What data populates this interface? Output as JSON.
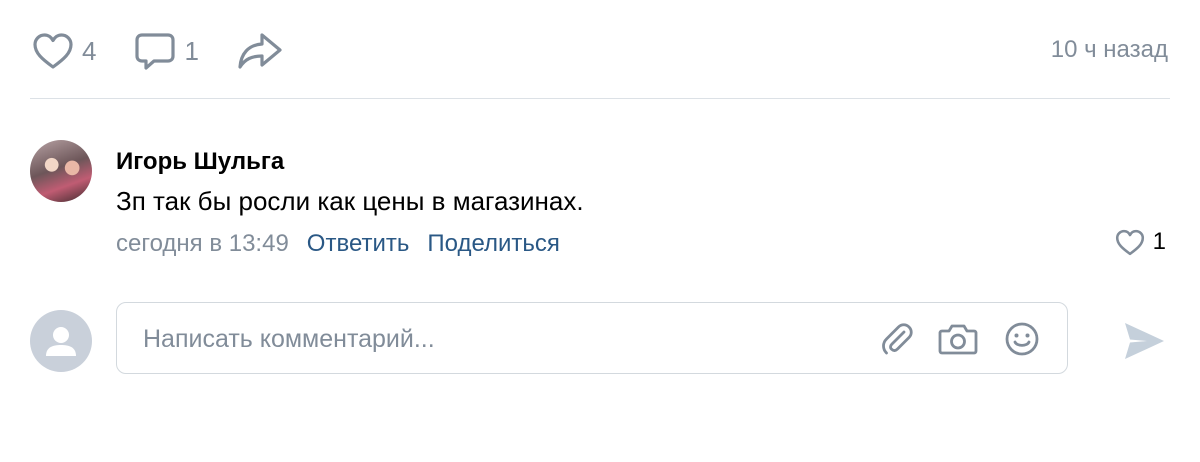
{
  "post_actions": {
    "like_count": "4",
    "comment_count": "1",
    "timestamp": "10 ч назад"
  },
  "comment": {
    "author": "Игорь Шульга",
    "text": "Зп так бы росли как цены в магазинах.",
    "time": "сегодня в 13:49",
    "reply_label": "Ответить",
    "share_label": "Поделиться",
    "like_count": "1"
  },
  "composer": {
    "placeholder": "Написать комментарий..."
  },
  "icons": {
    "like": "heart-icon",
    "comment": "comment-bubble-icon",
    "share": "share-arrow-icon",
    "attach": "paperclip-icon",
    "camera": "camera-icon",
    "emoji": "smiley-icon",
    "send": "send-icon",
    "avatar_placeholder": "user-silhouette-icon"
  },
  "colors": {
    "icon_gray": "#818c99",
    "link_blue": "#2a5885",
    "divider": "#dce1e6",
    "input_border": "#d3d9de",
    "send_disabled": "#c5d0db"
  }
}
